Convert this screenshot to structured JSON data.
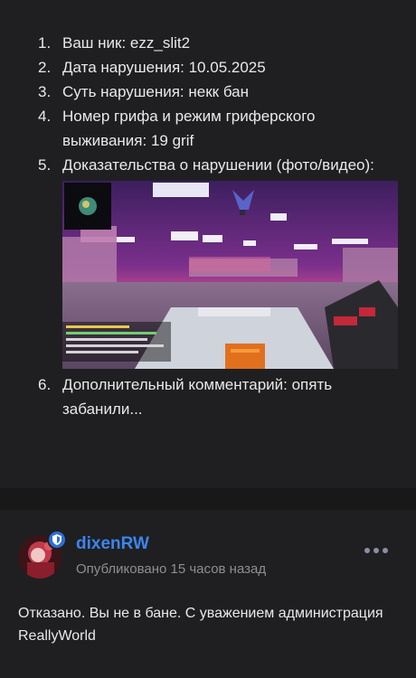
{
  "post": {
    "items": [
      {
        "num": "1.",
        "text": "Ваш ник: ezz_slit2"
      },
      {
        "num": "2.",
        "text": "Дата нарушения: 10.05.2025"
      },
      {
        "num": "3.",
        "text": "Суть нарушения: некк бан"
      },
      {
        "num": "4.",
        "text": "Номер грифа и режим гриферского выживания: 19 grif"
      },
      {
        "num": "5.",
        "text": "Доказательства о нарушении (фото/видео):"
      },
      {
        "num": "6.",
        "text": "Дополнительный комментарий: опять забанили..."
      }
    ]
  },
  "comment": {
    "author": "dixenRW",
    "meta": "Опубликовано 15 часов назад",
    "text": "Отказано. Вы не в бане. С уважением администрация ReallyWorld",
    "badge_icon": "shield-icon",
    "more_icon": "more-dots-icon"
  },
  "colors": {
    "background": "#1f1f21",
    "divider": "#181819",
    "author": "#3a86f0",
    "badge": "#2d6fd6",
    "meta": "#8e8e93"
  }
}
